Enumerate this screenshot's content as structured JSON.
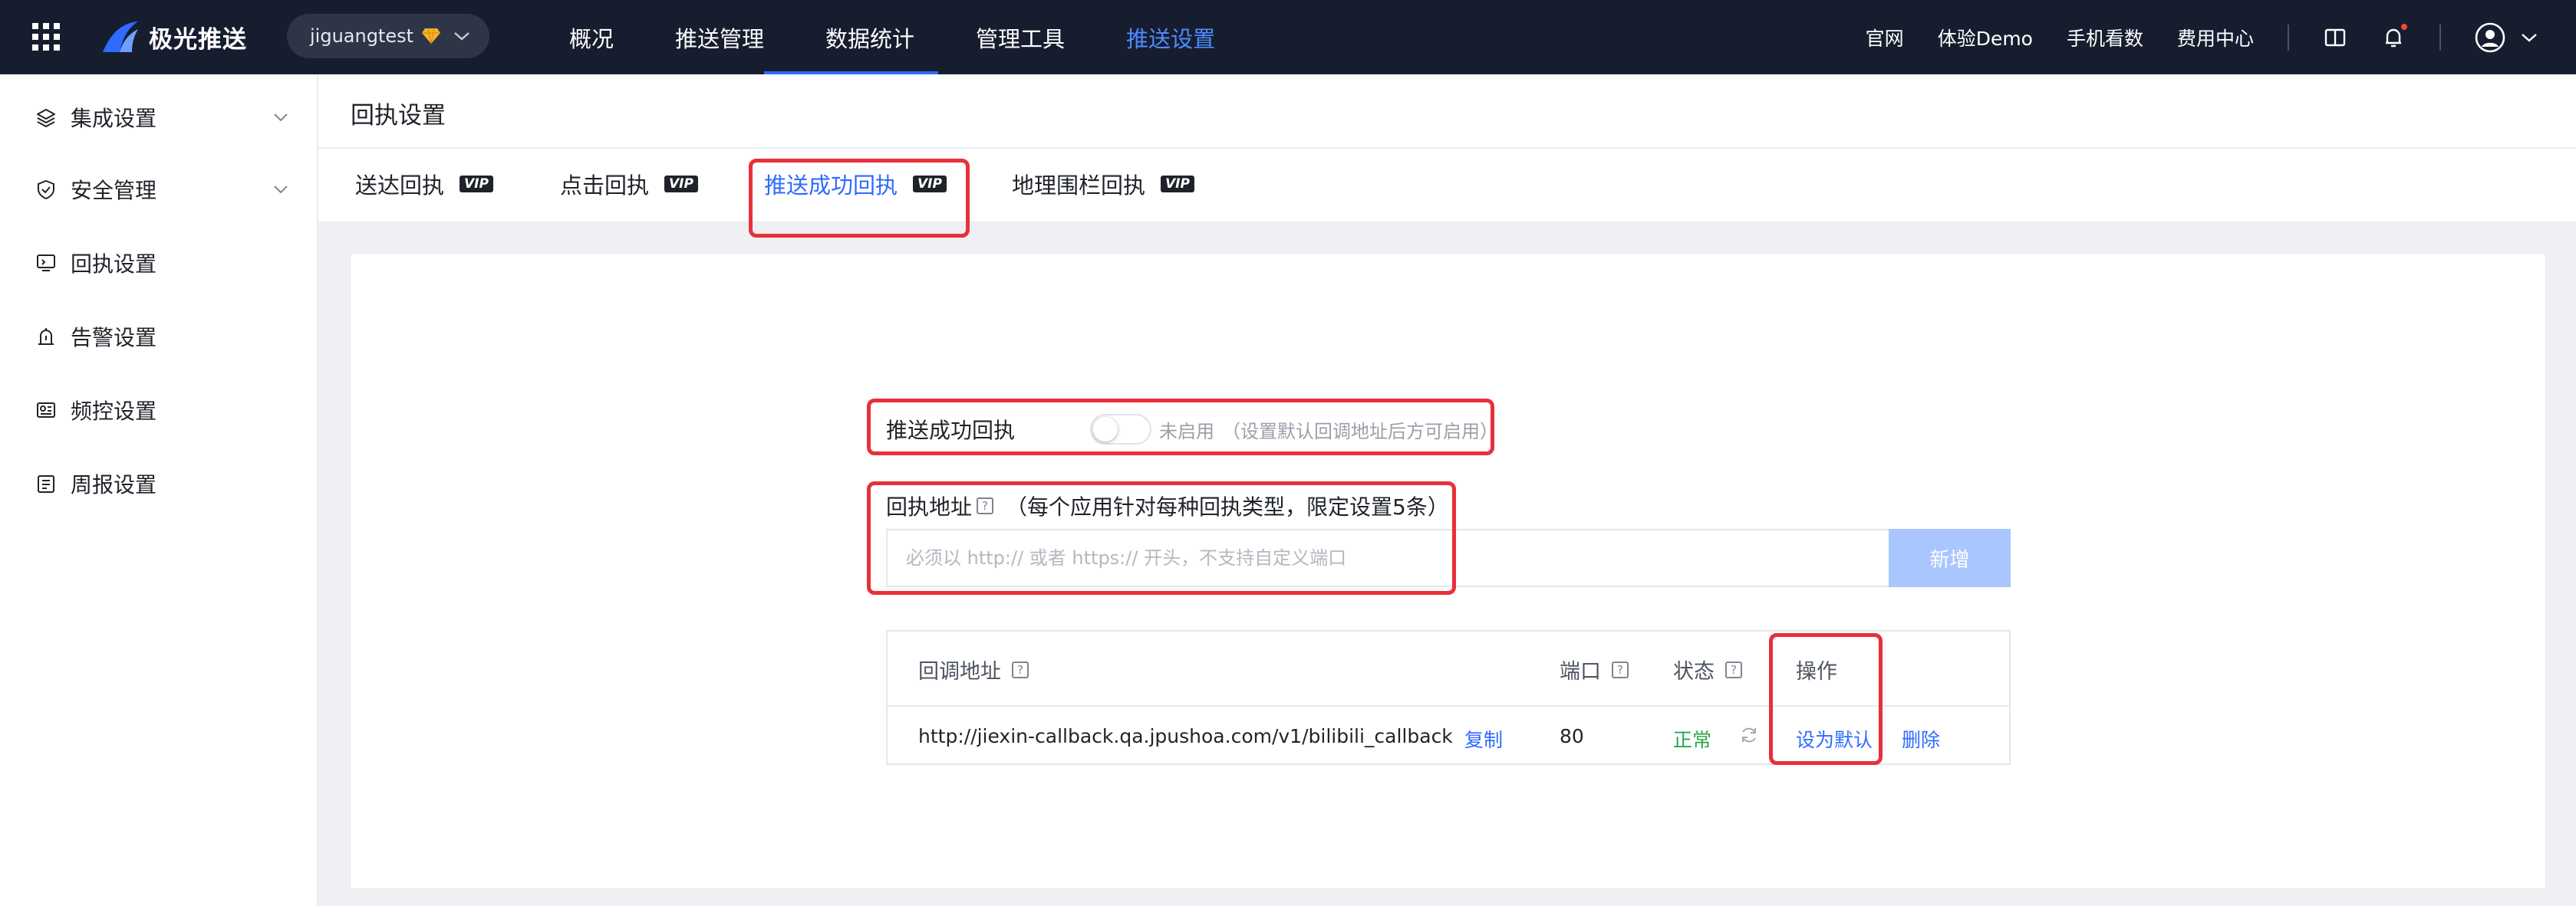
{
  "topbar": {
    "brand": "极光推送",
    "app_selector": "jiguangtest",
    "nav": [
      "概况",
      "推送管理",
      "数据统计",
      "管理工具",
      "推送设置"
    ],
    "right_links": [
      "官网",
      "体验Demo",
      "手机看数",
      "费用中心"
    ],
    "colors": {
      "bg": "#161d2f",
      "active": "#4d8cff"
    }
  },
  "sidebar": {
    "items": [
      {
        "label": "集成设置",
        "icon": "layers-icon",
        "expandable": true
      },
      {
        "label": "安全管理",
        "icon": "shield-check-icon",
        "expandable": true
      },
      {
        "label": "回执设置",
        "icon": "receipt-monitor-icon",
        "expandable": false
      },
      {
        "label": "告警设置",
        "icon": "alarm-icon",
        "expandable": false
      },
      {
        "label": "频控设置",
        "icon": "frequency-icon",
        "expandable": false
      },
      {
        "label": "周报设置",
        "icon": "report-icon",
        "expandable": false
      }
    ]
  },
  "page": {
    "title": "回执设置"
  },
  "tabs": {
    "items": [
      {
        "label": "送达回执",
        "badge": "VIP"
      },
      {
        "label": "点击回执",
        "badge": "VIP"
      },
      {
        "label": "推送成功回执",
        "badge": "VIP"
      },
      {
        "label": "地理围栏回执",
        "badge": "VIP"
      }
    ],
    "active": "推送成功回执"
  },
  "form": {
    "toggle_label": "推送成功回执",
    "toggle_on": false,
    "toggle_state": "未启用",
    "toggle_hint": "（设置默认回调地址后方可启用）",
    "address_label": "回执地址",
    "address_help": "?",
    "address_note": "（每个应用针对每种回执类型，限定设置5条）",
    "address_value": "",
    "address_placeholder": "必须以 http:// 或者 https:// 开头，不支持自定义端口",
    "add_button": "新增"
  },
  "table": {
    "headers": {
      "callback": "回调地址",
      "port": "端口",
      "status": "状态",
      "action": "操作",
      "help": "?"
    },
    "rows": [
      {
        "url": "http://jiexin-callback.qa.jpushoa.com/v1/bilibili_callback",
        "copy": "复制",
        "port": "80",
        "status": "正常",
        "set_default": "设为默认",
        "delete": "删除"
      }
    ]
  },
  "highlight_color": "#e8303a"
}
